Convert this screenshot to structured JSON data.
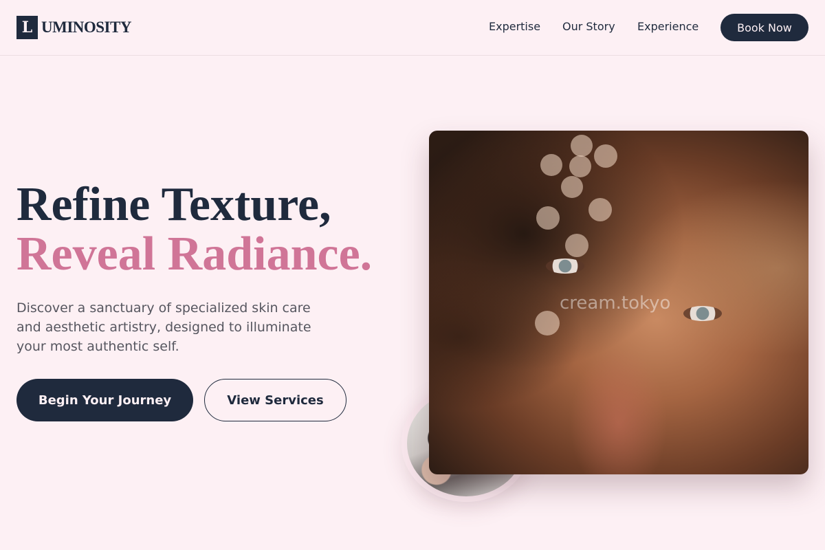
{
  "header": {
    "logo_mark": "L",
    "logo_text": "UMINOSITY",
    "nav": [
      "Expertise",
      "Our Story",
      "Experience"
    ],
    "cta_label": "Book Now"
  },
  "hero": {
    "title_line1": "Refine Texture,",
    "title_line2": "Reveal Radiance.",
    "description": "Discover a sanctuary of specialized skin care and aesthetic artistry, designed to illuminate your most authentic self.",
    "primary_button": "Begin Your Journey",
    "secondary_button": "View Services"
  },
  "images": {
    "main_photo_watermark": "cream.tokyo"
  },
  "colors": {
    "background": "#fdf0f4",
    "navy": "#1f2a3d",
    "accent_pink": "#d07597",
    "body_text": "#56565f"
  }
}
